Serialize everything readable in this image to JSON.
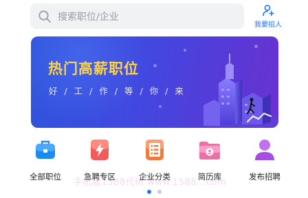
{
  "search": {
    "placeholder": "搜索职位/企业"
  },
  "recruit": {
    "label": "我要招人"
  },
  "banner": {
    "title": "热门高薪职位",
    "subtitle": "好 / 工 / 作 / 等 / 你 / 来"
  },
  "entries": [
    {
      "label": "全部职位",
      "icon": "briefcase-icon"
    },
    {
      "label": "急聘专区",
      "icon": "lightning-icon"
    },
    {
      "label": "企业分类",
      "icon": "list-icon"
    },
    {
      "label": "简历库",
      "icon": "folder-icon"
    },
    {
      "label": "发布招聘",
      "icon": "person-icon"
    }
  ],
  "watermark": "手机版1588代码  www.1588...com",
  "pager": {
    "pages": 2,
    "active": 1
  },
  "colors": {
    "accent": "#1f73f6",
    "banner_title": "#ffd43d"
  }
}
